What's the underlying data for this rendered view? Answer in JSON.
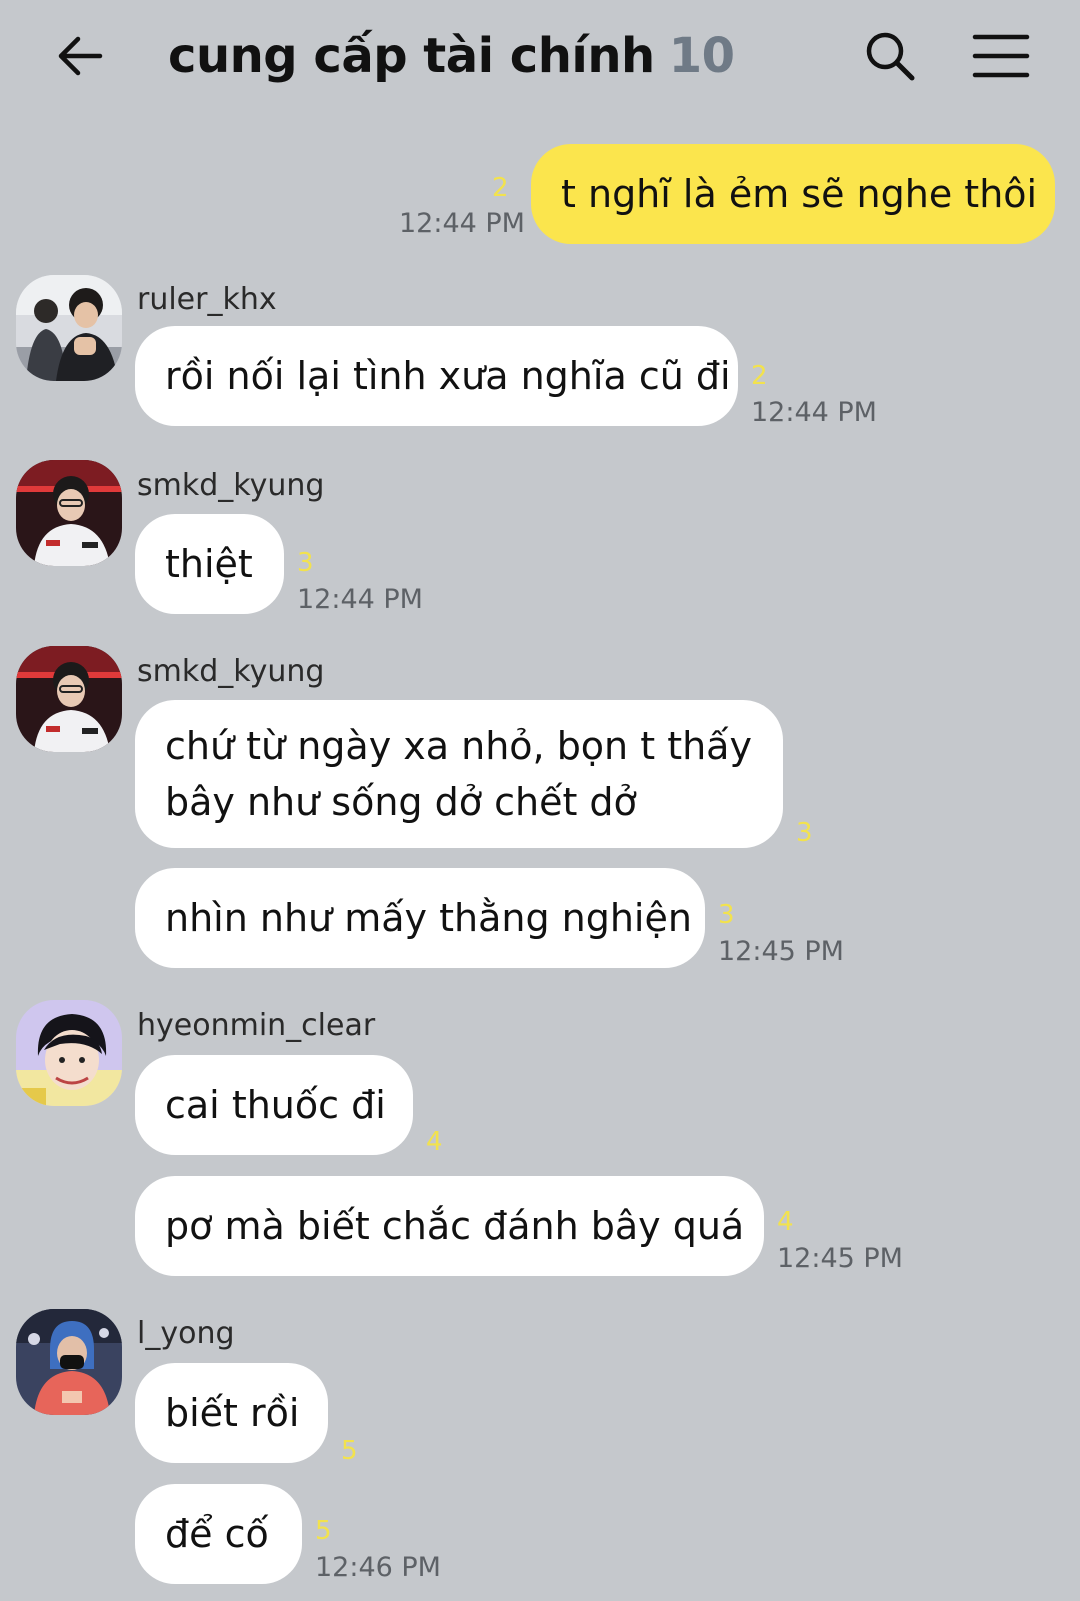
{
  "header": {
    "title": "cung cấp tài chính",
    "member_count": "10"
  },
  "messages": {
    "m1": {
      "text": "t nghĩ là ẻm sẽ nghe thôi",
      "unread": "2",
      "time": "12:44 PM"
    },
    "g1": {
      "sender": "ruler_khx",
      "m1": {
        "text": "rồi nối lại tình xưa nghĩa cũ đi",
        "unread": "2",
        "time": "12:44 PM"
      }
    },
    "g2": {
      "sender": "smkd_kyung",
      "m1": {
        "text": "thiệt",
        "unread": "3",
        "time": "12:44 PM"
      }
    },
    "g3": {
      "sender": "smkd_kyung",
      "m1": {
        "text": "chứ từ ngày xa nhỏ, bọn t thấy bây như sống dở chết dở",
        "unread": "3"
      },
      "m2": {
        "text": "nhìn như mấy thằng nghiện",
        "unread": "3",
        "time": "12:45 PM"
      }
    },
    "g4": {
      "sender": "hyeonmin_clear",
      "m1": {
        "text": "cai thuốc đi",
        "unread": "4"
      },
      "m2": {
        "text": "pơ mà biết chắc đánh bây quá",
        "unread": "4",
        "time": "12:45 PM"
      }
    },
    "g5": {
      "sender": "l_yong",
      "m1": {
        "text": "biết rồi",
        "unread": "5"
      },
      "m2": {
        "text": "để cố",
        "unread": "5",
        "time": "12:46 PM"
      }
    }
  }
}
